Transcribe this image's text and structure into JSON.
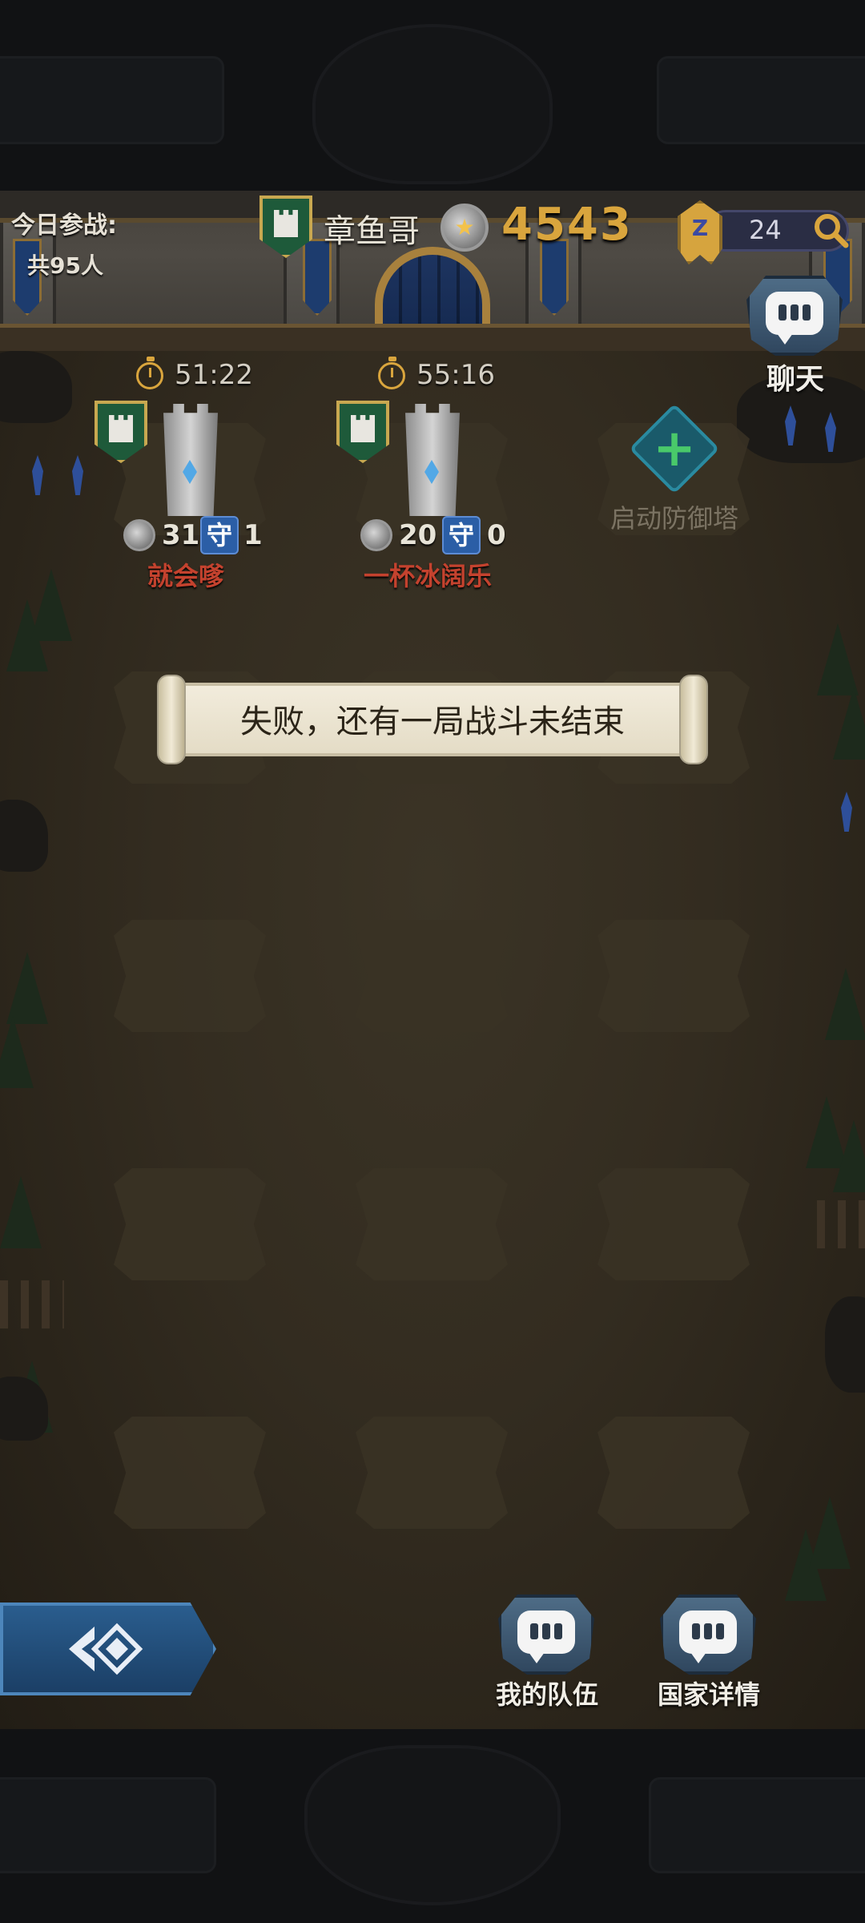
{
  "header": {
    "daily_label": "今日参战:",
    "daily_count": "共95人",
    "player_name": "章鱼哥",
    "score": "4543",
    "rank_letter": "Z",
    "rank_value": "24",
    "chat_label": "聊天"
  },
  "towers": [
    {
      "timer": "51:22",
      "level": "31",
      "guard_label": "守",
      "guards": "1",
      "owner": "就会嗲"
    },
    {
      "timer": "55:16",
      "level": "20",
      "guard_label": "守",
      "guards": "0",
      "owner": "一杯冰阔乐"
    }
  ],
  "add_tower_label": "启动防御塔",
  "toast": {
    "message": "失败，还有一局战斗未结束"
  },
  "bottom_nav": {
    "team_label": "我的队伍",
    "nation_label": "国家详情"
  },
  "colors": {
    "score_gold": "#d9a53d",
    "owner_red": "#c4422e",
    "guard_blue": "#2b5ea6",
    "shield_green": "#1e5a3a"
  }
}
